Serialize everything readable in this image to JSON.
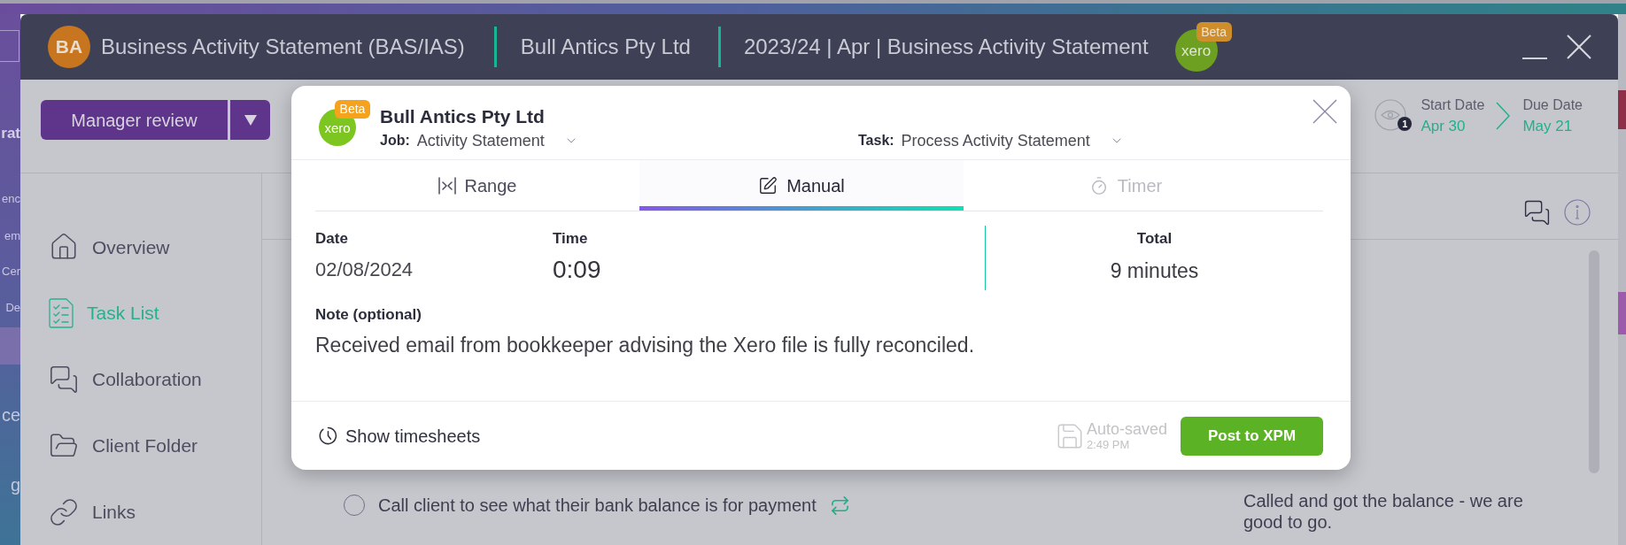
{
  "background_app": {
    "fragments": [
      {
        "text": "rat",
        "kind": "heading"
      },
      {
        "text": "enc",
        "kind": "item"
      },
      {
        "text": "em",
        "kind": "item"
      },
      {
        "text": "Cer",
        "kind": "item"
      },
      {
        "text": "De",
        "kind": "item"
      },
      {
        "text": "ce",
        "kind": "section"
      },
      {
        "text": "g",
        "kind": "section"
      }
    ]
  },
  "window": {
    "avatar": "BA",
    "title": "Business Activity Statement (BAS/IAS)",
    "client": "Bull Antics Pty Ltd",
    "period": "2023/24 | Apr | Business Activity Statement",
    "logo": {
      "text": "xero",
      "badge": "Beta"
    }
  },
  "toolbar": {
    "status_button": "Manager review",
    "watchers": {
      "count": "1"
    },
    "start_date": {
      "label": "Start Date",
      "value": "Apr 30"
    },
    "due_date": {
      "label": "Due Date",
      "value": "May 21"
    }
  },
  "sidebar": {
    "items": [
      {
        "label": "Overview",
        "selected": false
      },
      {
        "label": "Task List",
        "selected": true
      },
      {
        "label": "Collaboration",
        "selected": false
      },
      {
        "label": "Client Folder",
        "selected": false
      },
      {
        "label": "Links",
        "selected": false
      }
    ]
  },
  "tasks": [
    {
      "text": "Call client to see what their bank balance is for payment",
      "checked": false,
      "recurring": true,
      "comment": "Called and got the balance - we are good to go."
    }
  ],
  "timesheet_dialog": {
    "logo": {
      "text": "xero",
      "badge": "Beta"
    },
    "client": "Bull Antics Pty Ltd",
    "job": {
      "label": "Job:",
      "value": "Activity Statement"
    },
    "task": {
      "label": "Task:",
      "value": "Process Activity Statement"
    },
    "tabs": [
      {
        "label": "Range",
        "selected": false,
        "disabled": false
      },
      {
        "label": "Manual",
        "selected": true,
        "disabled": false
      },
      {
        "label": "Timer",
        "selected": false,
        "disabled": true
      }
    ],
    "date": {
      "label": "Date",
      "value": "02/08/2024"
    },
    "time": {
      "label": "Time",
      "value": "0:09"
    },
    "total": {
      "label": "Total",
      "value": "9 minutes"
    },
    "note": {
      "label": "Note (optional)",
      "value": "Received email from bookkeeper advising the Xero file is fully reconciled."
    },
    "show_timesheets": "Show timesheets",
    "autosave": {
      "label": "Auto-saved",
      "time": "2:49 PM"
    },
    "post_button": "Post to XPM"
  }
}
